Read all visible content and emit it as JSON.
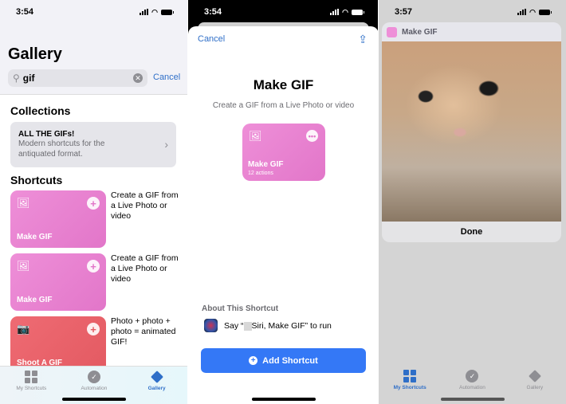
{
  "screens": [
    {
      "status": {
        "time": "3:54"
      },
      "title": "Gallery",
      "search": {
        "value": "gif",
        "cancel_label": "Cancel"
      },
      "collections": {
        "heading": "Collections",
        "items": [
          {
            "title": "ALL THE GIFs!",
            "description": "Modern shortcuts for the antiquated format."
          }
        ]
      },
      "shortcuts": {
        "heading": "Shortcuts",
        "items": [
          {
            "name": "Make GIF",
            "description": "Create a GIF from a Live Photo or video",
            "color": "#e87ecd",
            "icon": "photos-icon"
          },
          {
            "name": "Make GIF",
            "description": "Create a GIF from a Live Photo or video",
            "color": "#e87ecd",
            "icon": "photos-icon"
          },
          {
            "name": "Shoot A GIF",
            "description": "Photo + photo + photo = animated GIF!",
            "color": "#e8636b",
            "icon": "camera-icon"
          }
        ]
      },
      "tabbar": {
        "items": [
          {
            "label": "My Shortcuts",
            "active": false
          },
          {
            "label": "Automation",
            "active": false
          },
          {
            "label": "Gallery",
            "active": true
          }
        ]
      }
    },
    {
      "status": {
        "time": "3:54"
      },
      "cancel_label": "Cancel",
      "title": "Make GIF",
      "subtitle": "Create a GIF from a Live Photo or video",
      "card": {
        "name": "Make GIF",
        "actions": "12 actions",
        "color": "#e87ecd"
      },
      "about_heading": "About This Shortcut",
      "siri_phrase_prefix": "Say “",
      "siri_phrase_suffix": "Siri, Make GIF” to run",
      "add_button": "Add Shortcut"
    },
    {
      "status": {
        "time": "3:57"
      },
      "notification": {
        "app_name": "Make GIF",
        "done_label": "Done"
      },
      "tabbar": {
        "items": [
          {
            "label": "My Shortcuts",
            "active": true
          },
          {
            "label": "Automation",
            "active": false
          },
          {
            "label": "Gallery",
            "active": false
          }
        ]
      }
    }
  ],
  "colors": {
    "accent": "#2f6fc8",
    "button": "#3478f6",
    "pink_card": "#e87ecd",
    "red_card": "#e8636b"
  }
}
